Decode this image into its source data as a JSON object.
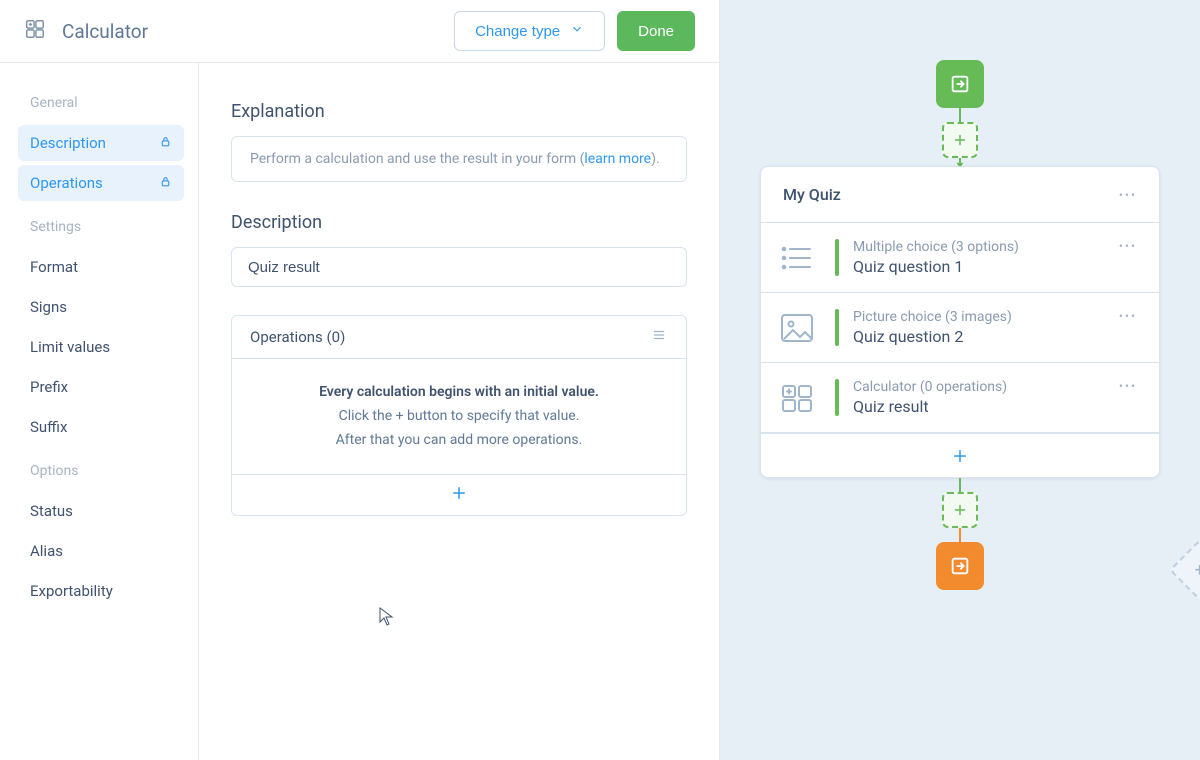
{
  "header": {
    "title": "Calculator",
    "change_type": "Change type",
    "done": "Done"
  },
  "sidebar": {
    "groups": [
      {
        "title": "General",
        "items": [
          {
            "label": "Description",
            "locked": true,
            "active": true
          },
          {
            "label": "Operations",
            "locked": true,
            "active": true
          }
        ]
      },
      {
        "title": "Settings",
        "items": [
          {
            "label": "Format"
          },
          {
            "label": "Signs"
          },
          {
            "label": "Limit values"
          },
          {
            "label": "Prefix"
          },
          {
            "label": "Suffix"
          }
        ]
      },
      {
        "title": "Options",
        "items": [
          {
            "label": "Status"
          },
          {
            "label": "Alias"
          },
          {
            "label": "Exportability"
          }
        ]
      }
    ]
  },
  "form": {
    "explanation_label": "Explanation",
    "explanation_pre": "Perform a calculation and use the result in your form (",
    "explanation_link": "learn more",
    "explanation_post": ").",
    "description_label": "Description",
    "description_value": "Quiz result",
    "operations_label": "Operations (0)",
    "ops_line1": "Every calculation begins with an initial value.",
    "ops_line2": "Click the + button to specify that value.",
    "ops_line3": "After that you can add more operations."
  },
  "flow": {
    "card_title": "My Quiz",
    "blocks": [
      {
        "type": "Multiple choice (3 options)",
        "name": "Quiz question 1",
        "icon": "list"
      },
      {
        "type": "Picture choice (3 images)",
        "name": "Quiz question 2",
        "icon": "image"
      },
      {
        "type": "Calculator (0 operations)",
        "name": "Quiz result",
        "icon": "calculator"
      }
    ]
  }
}
